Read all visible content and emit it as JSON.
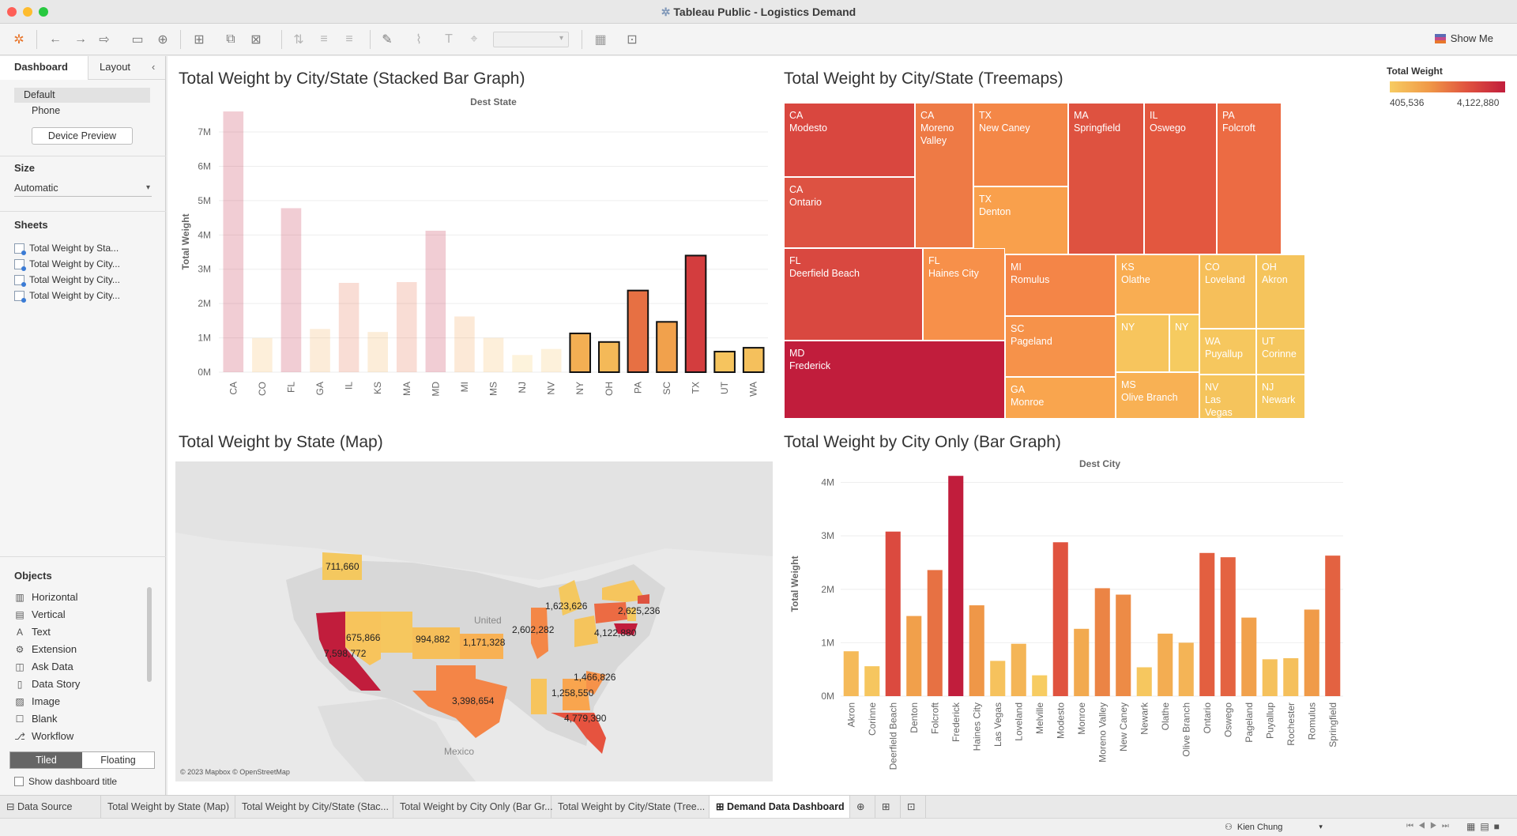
{
  "window": {
    "title": "Tableau Public - Logistics Demand"
  },
  "toolbar": {
    "show_me": "Show Me"
  },
  "sidebar": {
    "tabs": [
      "Dashboard",
      "Layout"
    ],
    "device": {
      "options": [
        "Default",
        "Phone"
      ],
      "preview_button": "Device Preview"
    },
    "size": {
      "title": "Size",
      "value": "Automatic"
    },
    "sheets": {
      "title": "Sheets",
      "items": [
        "Total Weight by Sta...",
        "Total Weight by City...",
        "Total Weight by City...",
        "Total Weight by City..."
      ]
    },
    "objects": {
      "title": "Objects",
      "items": [
        "Horizontal",
        "Vertical",
        "Text",
        "Extension",
        "Ask Data",
        "Data Story",
        "Image",
        "Blank",
        "Workflow"
      ]
    },
    "layout_toggle": [
      "Tiled",
      "Floating"
    ],
    "show_title": "Show dashboard title"
  },
  "dashboard": {
    "stacked": {
      "title": "Total Weight by City/State (Stacked Bar Graph)"
    },
    "treemap": {
      "title": "Total Weight by City/State (Treemaps)",
      "legend_title": "Total Weight",
      "legend_min": "405,536",
      "legend_max": "4,122,880",
      "cells": [
        {
          "line1": "CA",
          "line2": "Modesto",
          "color": "#d9473f"
        },
        {
          "line1": "CA",
          "line2": "Ontario",
          "color": "#dd5242"
        },
        {
          "line1": "CA",
          "line2": "Moreno",
          "line3": "Valley",
          "color": "#ee7a45"
        },
        {
          "line1": "TX",
          "line2": "New Caney",
          "color": "#f48747"
        },
        {
          "line1": "TX",
          "line2": "Denton",
          "color": "#f9a04c"
        },
        {
          "line1": "MA",
          "line2": "Springfield",
          "color": "#de5240"
        },
        {
          "line1": "IL",
          "line2": "Oswego",
          "color": "#e3573f"
        },
        {
          "line1": "PA",
          "line2": "Folcroft",
          "color": "#ec6b43"
        },
        {
          "line1": "FL",
          "line2": "Deerfield Beach",
          "color": "#d94840"
        },
        {
          "line1": "FL",
          "line2": "Haines City",
          "color": "#f7904a"
        },
        {
          "line1": "MD",
          "line2": "Frederick",
          "color": "#c11d3c"
        },
        {
          "line1": "MI",
          "line2": "Romulus",
          "color": "#f48547"
        },
        {
          "line1": "SC",
          "line2": "Pageland",
          "color": "#f6924a"
        },
        {
          "line1": "GA",
          "line2": "Monroe",
          "color": "#f9a54e"
        },
        {
          "line1": "KS",
          "line2": "Olathe",
          "color": "#f9ad52"
        },
        {
          "line1": "NY",
          "line2": "",
          "color": "#f7c55d"
        },
        {
          "line1": "NY",
          "line2": "",
          "color": "#f6cb60"
        },
        {
          "line1": "MS",
          "line2": "Olive Branch",
          "color": "#f8b154"
        },
        {
          "line1": "CO",
          "line2": "Loveland",
          "color": "#f6bf5a"
        },
        {
          "line1": "OH",
          "line2": "Akron",
          "color": "#f5c45c"
        },
        {
          "line1": "WA",
          "line2": "Puyallup",
          "color": "#f6c75e"
        },
        {
          "line1": "UT",
          "line2": "Corinne",
          "color": "#f5c75e"
        },
        {
          "line1": "NV",
          "line2": "Las Vegas",
          "color": "#f5c45c"
        },
        {
          "line1": "NJ",
          "line2": "Newark",
          "color": "#f5c85e"
        }
      ]
    },
    "map": {
      "title": "Total Weight by State (Map)",
      "credit": "© 2023 Mapbox © OpenStreetMap",
      "place_labels": [
        "United",
        "Mexico"
      ],
      "labels": [
        "711,660",
        "675,866",
        "994,882",
        "1,171,328",
        "7,598,772",
        "3,398,654",
        "2,602,282",
        "1,623,626",
        "2,625,236",
        "4,122,880",
        "1,466,826",
        "1,258,550",
        "4,779,390"
      ]
    },
    "citybar": {
      "title": "Total Weight by City Only (Bar Graph)"
    }
  },
  "chart_data": [
    {
      "type": "bar",
      "title": "Dest State",
      "ylabel": "Total Weight",
      "ylim": [
        0,
        7600000
      ],
      "yticks": [
        "0M",
        "1M",
        "2M",
        "3M",
        "4M",
        "5M",
        "6M",
        "7M"
      ],
      "categories": [
        "CA",
        "CO",
        "FL",
        "GA",
        "IL",
        "KS",
        "MA",
        "MD",
        "MI",
        "MS",
        "NJ",
        "NV",
        "NY",
        "OH",
        "PA",
        "SC",
        "TX",
        "UT",
        "WA"
      ],
      "values": [
        7598772,
        994882,
        4779390,
        1258550,
        2602282,
        1171328,
        2625236,
        4122880,
        1623626,
        1000000,
        500000,
        675866,
        1130000,
        880000,
        2380000,
        1466826,
        3398654,
        600000,
        711660
      ],
      "highlighted": [
        "NY",
        "OH",
        "PA",
        "SC",
        "TX",
        "UT",
        "WA"
      ]
    },
    {
      "type": "bar",
      "title": "Dest City",
      "ylabel": "Total Weight",
      "ylim": [
        0,
        4200000
      ],
      "yticks": [
        "0M",
        "1M",
        "2M",
        "3M",
        "4M"
      ],
      "categories": [
        "Akron",
        "Corinne",
        "Deerfield Beach",
        "Denton",
        "Folcroft",
        "Frederick",
        "Haines City",
        "Las Vegas",
        "Loveland",
        "Melville",
        "Modesto",
        "Monroe",
        "Moreno Valley",
        "New Caney",
        "Newark",
        "Olathe",
        "Olive Branch",
        "Ontario",
        "Oswego",
        "Pageland",
        "Puyallup",
        "Rochester",
        "Romulus",
        "Springfield"
      ],
      "values": [
        840000,
        560000,
        3080000,
        1500000,
        2360000,
        4122880,
        1700000,
        660000,
        980000,
        390000,
        2880000,
        1260000,
        2020000,
        1900000,
        540000,
        1170000,
        1000000,
        2680000,
        2600000,
        1470000,
        690000,
        710000,
        1620000,
        2630000
      ]
    }
  ]
}
